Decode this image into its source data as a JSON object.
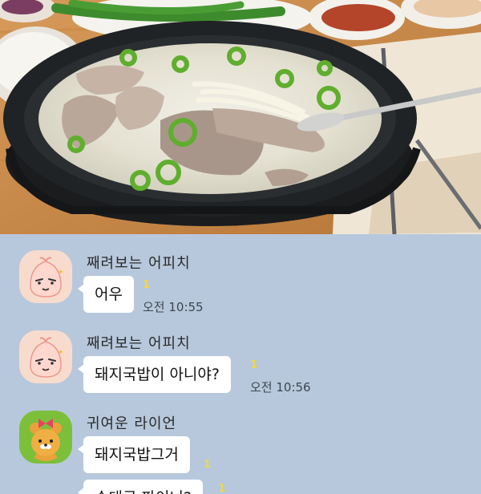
{
  "messages": [
    {
      "sender": "째려보는 어피치",
      "text": "어우",
      "unread": "1",
      "time": "오전 10:55",
      "avatar_icon": "apeach-icon"
    },
    {
      "sender": "째려보는 어피치",
      "text": "돼지국밥이 아니야?",
      "unread": "1",
      "time": "오전 10:56",
      "avatar_icon": "apeach-icon"
    },
    {
      "sender": "귀여운 라이언",
      "text": "돼지국밥그거",
      "unread": "1",
      "time": "",
      "avatar_icon": "ryan-icon"
    },
    {
      "sender": "",
      "text": "순대국 파이니?",
      "unread": "1",
      "time": "",
      "avatar_icon": ""
    }
  ],
  "colors": {
    "chat_bg": "#b7c8dc",
    "bubble": "#ffffff",
    "unread": "#f2d64a",
    "apeach_bg": "#f7dccd",
    "ryan_bg": "#7cbf3a"
  }
}
